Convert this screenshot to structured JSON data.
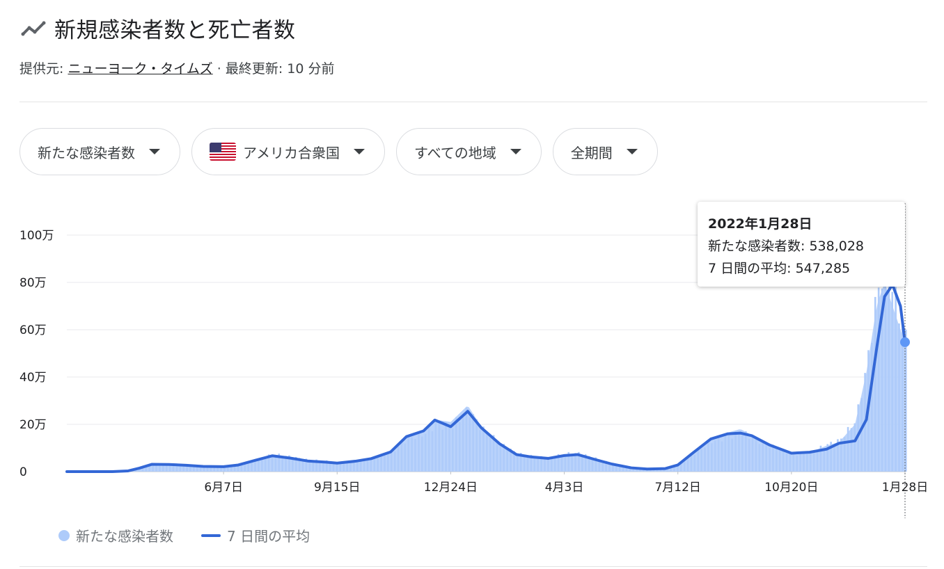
{
  "header": {
    "title": "新規感染者数と死亡者数",
    "title_icon": "trending-line-icon"
  },
  "source": {
    "prefix": "提供元: ",
    "link": "ニューヨーク・タイムズ",
    "updated": " · 最終更新: 10 分前"
  },
  "filters": [
    {
      "label": "新たな感染者数"
    },
    {
      "label": "アメリカ合衆国",
      "icon": "us-flag-icon"
    },
    {
      "label": "すべての地域"
    },
    {
      "label": "全期間"
    }
  ],
  "tooltip": {
    "date": "2022年1月28日",
    "cases_label": "新たな感染者数: 538,028",
    "avg_label": "7 日間の平均: 547,285"
  },
  "legend": {
    "cases": "新たな感染者数",
    "avg": "7 日間の平均"
  },
  "colors": {
    "bars": "#aecbfa",
    "line": "#3367d6",
    "grid": "#e8eaed"
  },
  "chart_data": {
    "type": "bar",
    "title": "新規感染者数と死亡者数",
    "y_unit": "万",
    "ylim": [
      0,
      1000000
    ],
    "y_ticks": [
      {
        "value": 0,
        "label": "0"
      },
      {
        "value": 200000,
        "label": "20万"
      },
      {
        "value": 400000,
        "label": "40万"
      },
      {
        "value": 600000,
        "label": "60万"
      },
      {
        "value": 800000,
        "label": "80万"
      },
      {
        "value": 1000000,
        "label": "100万"
      }
    ],
    "x_ticks": [
      {
        "date": "2020-06-07",
        "label": "6月7日"
      },
      {
        "date": "2020-09-15",
        "label": "9月15日"
      },
      {
        "date": "2020-12-24",
        "label": "12月24日"
      },
      {
        "date": "2021-04-03",
        "label": "4月3日"
      },
      {
        "date": "2021-07-12",
        "label": "7月12日"
      },
      {
        "date": "2021-10-20",
        "label": "10月20日"
      },
      {
        "date": "2022-01-28",
        "label": "1月28日"
      }
    ],
    "grid": true,
    "legend_position": "bottom-left",
    "highlighted_point": {
      "date": "2022-01-28",
      "cases": 538028,
      "avg": 547285
    },
    "series": [
      {
        "name": "新たな感染者数",
        "kind": "bar",
        "points": [
          [
            "2020-01-21",
            0
          ],
          [
            "2020-03-01",
            0
          ],
          [
            "2020-03-15",
            5000
          ],
          [
            "2020-03-25",
            15000
          ],
          [
            "2020-04-05",
            30000
          ],
          [
            "2020-04-20",
            29000
          ],
          [
            "2020-05-05",
            25000
          ],
          [
            "2020-05-20",
            22000
          ],
          [
            "2020-06-07",
            20000
          ],
          [
            "2020-06-20",
            30000
          ],
          [
            "2020-07-05",
            48000
          ],
          [
            "2020-07-20",
            68000
          ],
          [
            "2020-08-05",
            58000
          ],
          [
            "2020-08-20",
            45000
          ],
          [
            "2020-09-05",
            42000
          ],
          [
            "2020-09-15",
            36000
          ],
          [
            "2020-10-01",
            45000
          ],
          [
            "2020-10-15",
            55000
          ],
          [
            "2020-11-01",
            85000
          ],
          [
            "2020-11-15",
            150000
          ],
          [
            "2020-11-30",
            175000
          ],
          [
            "2020-12-10",
            220000
          ],
          [
            "2020-12-24",
            210000
          ],
          [
            "2021-01-08",
            280000
          ],
          [
            "2021-01-20",
            190000
          ],
          [
            "2021-02-05",
            120000
          ],
          [
            "2021-02-20",
            75000
          ],
          [
            "2021-03-05",
            62000
          ],
          [
            "2021-03-20",
            55000
          ],
          [
            "2021-04-03",
            70000
          ],
          [
            "2021-04-15",
            72000
          ],
          [
            "2021-05-01",
            50000
          ],
          [
            "2021-05-15",
            30000
          ],
          [
            "2021-06-01",
            15000
          ],
          [
            "2021-06-15",
            12000
          ],
          [
            "2021-07-01",
            15000
          ],
          [
            "2021-07-12",
            30000
          ],
          [
            "2021-07-25",
            80000
          ],
          [
            "2021-08-10",
            140000
          ],
          [
            "2021-08-25",
            165000
          ],
          [
            "2021-09-05",
            180000
          ],
          [
            "2021-09-15",
            155000
          ],
          [
            "2021-10-01",
            115000
          ],
          [
            "2021-10-20",
            75000
          ],
          [
            "2021-11-05",
            80000
          ],
          [
            "2021-11-20",
            110000
          ],
          [
            "2021-12-01",
            125000
          ],
          [
            "2021-12-15",
            200000
          ],
          [
            "2021-12-25",
            420000
          ],
          [
            "2022-01-03",
            700000
          ],
          [
            "2022-01-10",
            800000
          ],
          [
            "2022-01-17",
            700000
          ],
          [
            "2022-01-24",
            600000
          ],
          [
            "2022-01-28",
            538028
          ]
        ]
      },
      {
        "name": "7 日間の平均",
        "kind": "line",
        "points": [
          [
            "2020-01-21",
            0
          ],
          [
            "2020-03-01",
            0
          ],
          [
            "2020-03-15",
            3000
          ],
          [
            "2020-03-25",
            15000
          ],
          [
            "2020-04-05",
            31000
          ],
          [
            "2020-04-20",
            30000
          ],
          [
            "2020-05-05",
            27000
          ],
          [
            "2020-05-20",
            22000
          ],
          [
            "2020-06-07",
            21000
          ],
          [
            "2020-06-20",
            28000
          ],
          [
            "2020-07-05",
            48000
          ],
          [
            "2020-07-20",
            67000
          ],
          [
            "2020-08-05",
            57000
          ],
          [
            "2020-08-20",
            45000
          ],
          [
            "2020-09-05",
            40000
          ],
          [
            "2020-09-15",
            36000
          ],
          [
            "2020-10-01",
            44000
          ],
          [
            "2020-10-15",
            55000
          ],
          [
            "2020-11-01",
            83000
          ],
          [
            "2020-11-15",
            148000
          ],
          [
            "2020-11-30",
            172000
          ],
          [
            "2020-12-10",
            218000
          ],
          [
            "2020-12-24",
            190000
          ],
          [
            "2021-01-08",
            255000
          ],
          [
            "2021-01-20",
            185000
          ],
          [
            "2021-02-05",
            118000
          ],
          [
            "2021-02-20",
            72000
          ],
          [
            "2021-03-05",
            62000
          ],
          [
            "2021-03-20",
            56000
          ],
          [
            "2021-04-03",
            68000
          ],
          [
            "2021-04-15",
            72000
          ],
          [
            "2021-05-01",
            50000
          ],
          [
            "2021-05-15",
            32000
          ],
          [
            "2021-06-01",
            16000
          ],
          [
            "2021-06-15",
            11000
          ],
          [
            "2021-07-01",
            13000
          ],
          [
            "2021-07-12",
            28000
          ],
          [
            "2021-07-25",
            78000
          ],
          [
            "2021-08-10",
            138000
          ],
          [
            "2021-08-25",
            160000
          ],
          [
            "2021-09-05",
            163000
          ],
          [
            "2021-09-15",
            152000
          ],
          [
            "2021-10-01",
            112000
          ],
          [
            "2021-10-20",
            78000
          ],
          [
            "2021-11-05",
            82000
          ],
          [
            "2021-11-20",
            95000
          ],
          [
            "2021-12-01",
            120000
          ],
          [
            "2021-12-15",
            130000
          ],
          [
            "2021-12-25",
            220000
          ],
          [
            "2022-01-03",
            520000
          ],
          [
            "2022-01-10",
            740000
          ],
          [
            "2022-01-17",
            790000
          ],
          [
            "2022-01-24",
            700000
          ],
          [
            "2022-01-28",
            547285
          ]
        ]
      }
    ]
  }
}
